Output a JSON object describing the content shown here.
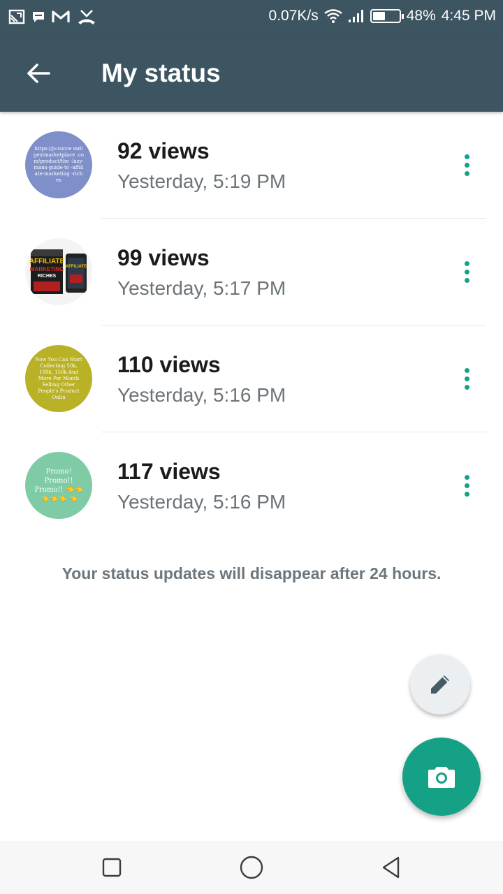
{
  "status_bar": {
    "net_speed": "0.07K/s",
    "battery": "48%",
    "battery_level": 0.48,
    "time": "4:45 PM",
    "icons": [
      "cast-icon",
      "message-icon",
      "gmail-icon",
      "missed-call-icon",
      "wifi-icon",
      "signal-icon",
      "battery-icon"
    ]
  },
  "app_bar": {
    "title": "My status"
  },
  "statuses": [
    {
      "views": "92 views",
      "time": "Yesterday, 5:19 PM",
      "thumb_text": "https://jv.succe ssdigestmarketplace .com/product/the -lazy-mans-guide-to -affiliate-marketing -riches",
      "color": "#7f8fc9"
    },
    {
      "views": "99 views",
      "time": "Yesterday, 5:17 PM",
      "thumb_text": "AFFILIATE MARKETING RICHES",
      "color": "#f4f4f4"
    },
    {
      "views": "110 views",
      "time": "Yesterday, 5:16 PM",
      "thumb_text": "Now You Can Start Collecting 50k, 100k, 150k And More Per Month Selling Other People's Product Onlin",
      "color": "#b9b126"
    },
    {
      "views": "117 views",
      "time": "Yesterday, 5:16 PM",
      "thumb_text": "Promo! Promo!! Promo!! 👈👈👈👈👈 👈",
      "color": "#7ecba6"
    }
  ],
  "footnote": "Your status updates will disappear after 24 hours.",
  "colors": {
    "header": "#3c5561",
    "accent": "#15a186"
  }
}
